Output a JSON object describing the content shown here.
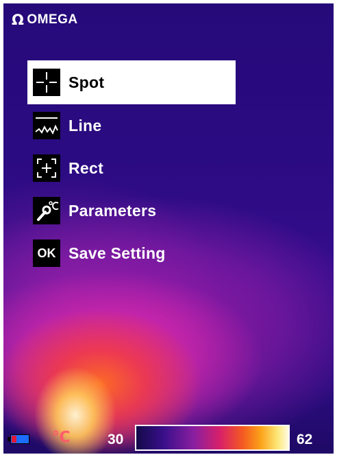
{
  "brand": {
    "name": "OMEGA",
    "icon": "omega-logo-icon"
  },
  "menu": {
    "selected_index": 0,
    "items": [
      {
        "label": "Spot",
        "icon": "crosshair-icon"
      },
      {
        "label": "Line",
        "icon": "line-profile-icon"
      },
      {
        "label": "Rect",
        "icon": "rect-target-icon"
      },
      {
        "label": "Parameters",
        "icon": "wrench-celsius-icon"
      },
      {
        "label": "Save Setting",
        "icon": "ok-icon",
        "icon_text": "OK"
      }
    ]
  },
  "status": {
    "battery_icon": "battery-icon",
    "unit": "℃",
    "min_temp": "30",
    "max_temp": "62",
    "palette_colors": [
      "#140a4a",
      "#3a0f8a",
      "#8a1fa0",
      "#d8206a",
      "#f45a20",
      "#fca31a",
      "#fde87a",
      "#fffbe0"
    ]
  },
  "colors": {
    "background": "#2b0b82",
    "menu_highlight": "#ffffff",
    "icon_box": "#000000",
    "unit_color": "#ff5a6a",
    "battery_blue": "#1d6cff",
    "battery_red": "#e0183a"
  }
}
